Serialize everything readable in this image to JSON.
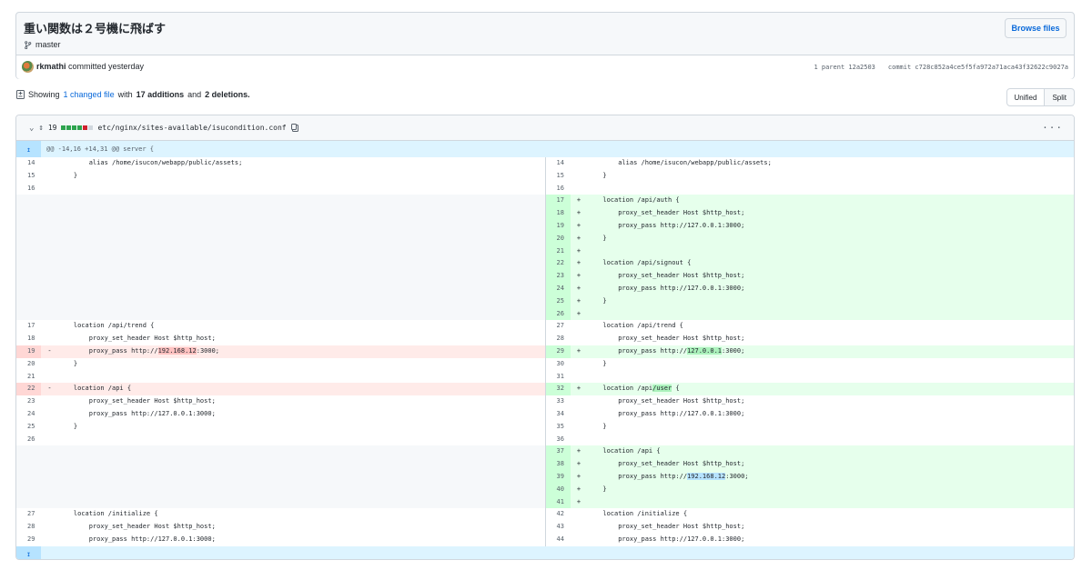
{
  "commit": {
    "title": "重い関数は２号機に飛ばす",
    "branch": "master",
    "browse_label": "Browse files",
    "author": "rkmathi",
    "action": "committed yesterday",
    "parent_label": "1 parent",
    "parent_sha": "12a2503",
    "commit_label": "commit",
    "commit_sha": "c728c852a4ce5f5fa972a71aca43f32622c9027a"
  },
  "summary": {
    "showing": "Showing",
    "changed": "1 changed file",
    "with": "with",
    "additions": "17 additions",
    "and": "and",
    "deletions": "2 deletions."
  },
  "view_toggle": {
    "unified": "Unified",
    "split": "Split"
  },
  "file": {
    "changes": "19",
    "path": "etc/nginx/sites-available/isucondition.conf",
    "hunk_header": "@@ -14,16 +14,31 @@ server {",
    "bar_colors": [
      "#2da44e",
      "#2da44e",
      "#2da44e",
      "#2da44e",
      "#cf222e",
      "#d0d7de"
    ]
  },
  "rows": [
    {
      "l": {
        "n": "14",
        "c": "        alias /home/isucon/webapp/public/assets;"
      },
      "r": {
        "n": "14",
        "c": "        alias /home/isucon/webapp/public/assets;"
      }
    },
    {
      "l": {
        "n": "15",
        "c": "    }"
      },
      "r": {
        "n": "15",
        "c": "    }"
      }
    },
    {
      "l": {
        "n": "16",
        "c": ""
      },
      "r": {
        "n": "16",
        "c": ""
      }
    },
    {
      "l": null,
      "r": {
        "n": "17",
        "t": "add",
        "c": "    location /api/auth {"
      }
    },
    {
      "l": null,
      "r": {
        "n": "18",
        "t": "add",
        "c": "        proxy_set_header Host $http_host;"
      }
    },
    {
      "l": null,
      "r": {
        "n": "19",
        "t": "add",
        "c": "        proxy_pass http://127.0.0.1:3000;"
      }
    },
    {
      "l": null,
      "r": {
        "n": "20",
        "t": "add",
        "c": "    }"
      }
    },
    {
      "l": null,
      "r": {
        "n": "21",
        "t": "add",
        "c": ""
      }
    },
    {
      "l": null,
      "r": {
        "n": "22",
        "t": "add",
        "c": "    location /api/signout {"
      }
    },
    {
      "l": null,
      "r": {
        "n": "23",
        "t": "add",
        "c": "        proxy_set_header Host $http_host;"
      }
    },
    {
      "l": null,
      "r": {
        "n": "24",
        "t": "add",
        "c": "        proxy_pass http://127.0.0.1:3000;"
      }
    },
    {
      "l": null,
      "r": {
        "n": "25",
        "t": "add",
        "c": "    }"
      }
    },
    {
      "l": null,
      "r": {
        "n": "26",
        "t": "add",
        "c": ""
      }
    },
    {
      "l": {
        "n": "17",
        "c": "    location /api/trend {"
      },
      "r": {
        "n": "27",
        "c": "    location /api/trend {"
      }
    },
    {
      "l": {
        "n": "18",
        "c": "        proxy_set_header Host $http_host;"
      },
      "r": {
        "n": "28",
        "c": "        proxy_set_header Host $http_host;"
      }
    },
    {
      "l": {
        "n": "19",
        "t": "del",
        "c": "        proxy_pass http://",
        "h": "192.168.12",
        "s": ":3000;"
      },
      "r": {
        "n": "29",
        "t": "add",
        "c": "        proxy_pass http://",
        "h": "127.0.0.1",
        "s": ":3000;"
      }
    },
    {
      "l": {
        "n": "20",
        "c": "    }"
      },
      "r": {
        "n": "30",
        "c": "    }"
      }
    },
    {
      "l": {
        "n": "21",
        "c": ""
      },
      "r": {
        "n": "31",
        "c": ""
      }
    },
    {
      "l": {
        "n": "22",
        "t": "del",
        "c": "    location /api {"
      },
      "r": {
        "n": "32",
        "t": "add",
        "c": "    location /api",
        "h": "/user",
        "s": " {"
      }
    },
    {
      "l": {
        "n": "23",
        "c": "        proxy_set_header Host $http_host;"
      },
      "r": {
        "n": "33",
        "c": "        proxy_set_header Host $http_host;"
      }
    },
    {
      "l": {
        "n": "24",
        "c": "        proxy_pass http://127.0.0.1:3000;"
      },
      "r": {
        "n": "34",
        "c": "        proxy_pass http://127.0.0.1:3000;"
      }
    },
    {
      "l": {
        "n": "25",
        "c": "    }"
      },
      "r": {
        "n": "35",
        "c": "    }"
      }
    },
    {
      "l": {
        "n": "26",
        "c": ""
      },
      "r": {
        "n": "36",
        "c": ""
      }
    },
    {
      "l": null,
      "r": {
        "n": "37",
        "t": "add",
        "c": "    location /api {"
      }
    },
    {
      "l": null,
      "r": {
        "n": "38",
        "t": "add",
        "c": "        proxy_set_header Host $http_host;"
      }
    },
    {
      "l": null,
      "r": {
        "n": "39",
        "t": "add",
        "c": "        proxy_pass http://",
        "h": "192.168.12",
        "hs": true,
        "s": ":3000;"
      }
    },
    {
      "l": null,
      "r": {
        "n": "40",
        "t": "add",
        "c": "    }"
      }
    },
    {
      "l": null,
      "r": {
        "n": "41",
        "t": "add",
        "c": ""
      }
    },
    {
      "l": {
        "n": "27",
        "c": "    location /initialize {"
      },
      "r": {
        "n": "42",
        "c": "    location /initialize {"
      }
    },
    {
      "l": {
        "n": "28",
        "c": "        proxy_set_header Host $http_host;"
      },
      "r": {
        "n": "43",
        "c": "        proxy_set_header Host $http_host;"
      }
    },
    {
      "l": {
        "n": "29",
        "c": "        proxy_pass http://127.0.0.1:3000;"
      },
      "r": {
        "n": "44",
        "c": "        proxy_pass http://127.0.0.1:3000;"
      }
    }
  ]
}
